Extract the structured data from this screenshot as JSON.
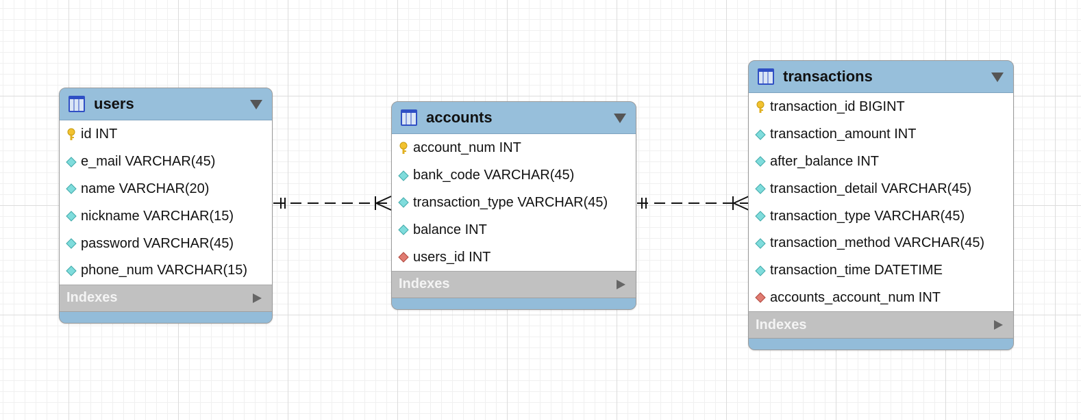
{
  "tables": [
    {
      "name": "users",
      "indexes_label": "Indexes",
      "columns": [
        {
          "text": "id INT",
          "icon": "primary-key-icon"
        },
        {
          "text": "e_mail VARCHAR(45)",
          "icon": "column-icon"
        },
        {
          "text": "name VARCHAR(20)",
          "icon": "column-icon"
        },
        {
          "text": "nickname VARCHAR(15)",
          "icon": "column-icon"
        },
        {
          "text": "password VARCHAR(45)",
          "icon": "column-icon"
        },
        {
          "text": "phone_num VARCHAR(15)",
          "icon": "column-icon"
        }
      ]
    },
    {
      "name": "accounts",
      "indexes_label": "Indexes",
      "columns": [
        {
          "text": "account_num INT",
          "icon": "primary-key-icon"
        },
        {
          "text": "bank_code VARCHAR(45)",
          "icon": "column-icon"
        },
        {
          "text": "transaction_type VARCHAR(45)",
          "icon": "column-icon"
        },
        {
          "text": "balance INT",
          "icon": "column-icon"
        },
        {
          "text": "users_id INT",
          "icon": "foreign-key-icon"
        }
      ]
    },
    {
      "name": "transactions",
      "indexes_label": "Indexes",
      "columns": [
        {
          "text": "transaction_id BIGINT",
          "icon": "primary-key-icon"
        },
        {
          "text": "transaction_amount INT",
          "icon": "column-icon"
        },
        {
          "text": "after_balance INT",
          "icon": "column-icon"
        },
        {
          "text": "transaction_detail VARCHAR(45)",
          "icon": "column-icon"
        },
        {
          "text": "transaction_type VARCHAR(45)",
          "icon": "column-icon"
        },
        {
          "text": "transaction_method VARCHAR(45)",
          "icon": "column-icon"
        },
        {
          "text": "transaction_time DATETIME",
          "icon": "column-icon"
        },
        {
          "text": "accounts_account_num INT",
          "icon": "foreign-key-icon"
        }
      ]
    }
  ],
  "relationships": [
    {
      "from": "users",
      "to": "accounts",
      "type": "one-to-many",
      "style": "dashed"
    },
    {
      "from": "accounts",
      "to": "transactions",
      "type": "one-to-many",
      "style": "dashed"
    }
  ],
  "colors": {
    "header": "#97bfdb",
    "indexes_bar": "#c1c1c1",
    "primary_key": "#f2c230",
    "column": "#7fdcdc",
    "foreign_key": "#e07c72"
  }
}
